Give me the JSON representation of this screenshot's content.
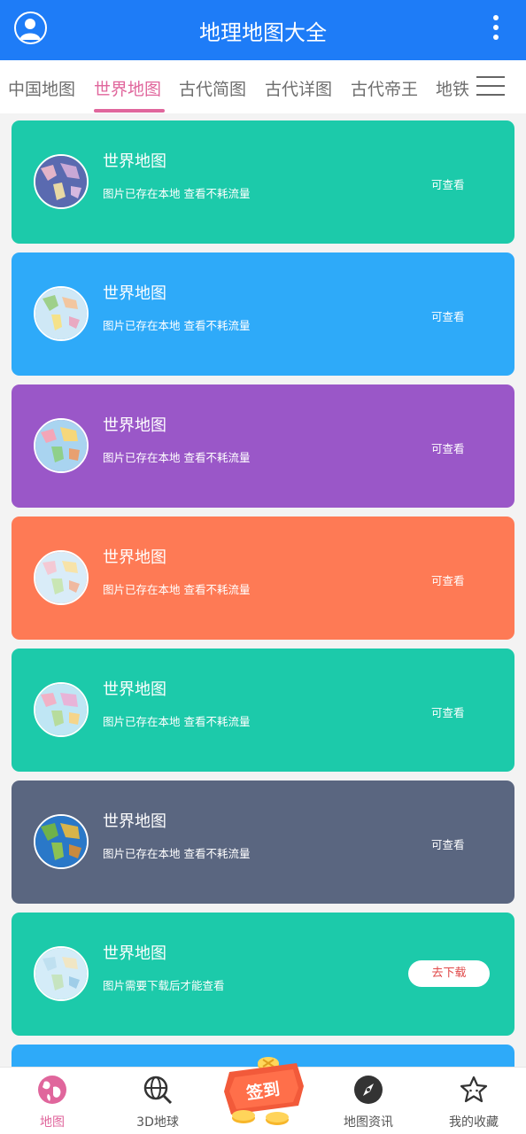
{
  "header": {
    "title": "地理地图大全",
    "avatar_icon": "user-avatar-icon",
    "more_icon": "more-vertical-icon",
    "color": "#1e7cf7"
  },
  "tabs": {
    "items": [
      "中国地图",
      "世界地图",
      "古代简图",
      "古代详图",
      "古代帝王",
      "地铁"
    ],
    "active_index": 1,
    "active_color": "#e0669c",
    "menu_icon": "hamburger-menu-icon"
  },
  "cards": [
    {
      "title": "世界地图",
      "desc": "图片已存在本地 查看不耗流量",
      "status": "可查看",
      "color": "#1ccaaa",
      "downloaded": true
    },
    {
      "title": "世界地图",
      "desc": "图片已存在本地 查看不耗流量",
      "status": "可查看",
      "color": "#2eaaf9",
      "downloaded": true
    },
    {
      "title": "世界地图",
      "desc": "图片已存在本地 查看不耗流量",
      "status": "可查看",
      "color": "#9a57c8",
      "downloaded": true
    },
    {
      "title": "世界地图",
      "desc": "图片已存在本地 查看不耗流量",
      "status": "可查看",
      "color": "#fe7a55",
      "downloaded": true
    },
    {
      "title": "世界地图",
      "desc": "图片已存在本地 查看不耗流量",
      "status": "可查看",
      "color": "#1ccaaa",
      "downloaded": true
    },
    {
      "title": "世界地图",
      "desc": "图片已存在本地 查看不耗流量",
      "status": "可查看",
      "color": "#5a6680",
      "downloaded": true
    },
    {
      "title": "世界地图",
      "desc": "图片需要下载后才能查看",
      "button": "去下载",
      "color": "#1ccaaa",
      "downloaded": false
    },
    {
      "title": "",
      "desc": "",
      "status": "",
      "color": "#2eaaf9",
      "downloaded": true
    }
  ],
  "bottom_nav": {
    "items": [
      {
        "label": "地图",
        "icon": "globe-icon",
        "active": true
      },
      {
        "label": "3D地球",
        "icon": "globe-search-icon",
        "active": false
      },
      {
        "label": "地图资讯",
        "icon": "compass-icon",
        "active": false
      },
      {
        "label": "我的收藏",
        "icon": "star-icon",
        "active": false
      }
    ],
    "signin_label": "签到",
    "signin_icon": "coins-badge-icon"
  }
}
